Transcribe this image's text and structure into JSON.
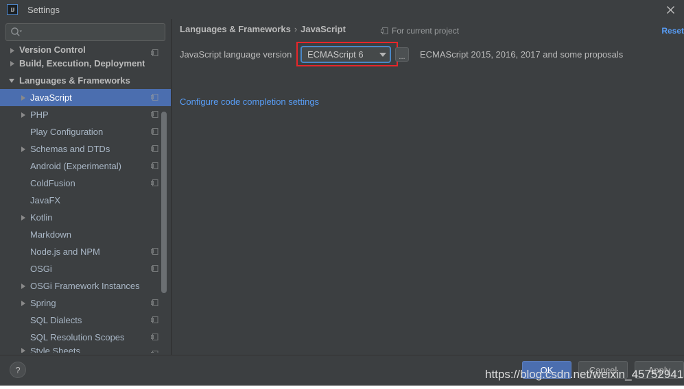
{
  "window": {
    "title": "Settings",
    "logo_text": "IJ",
    "close_icon": "close-icon"
  },
  "sidebar": {
    "search": {
      "value": "",
      "placeholder": "",
      "icon": "search-icon"
    },
    "items": [
      {
        "label": "Version Control",
        "arrow": "right",
        "bold": true,
        "selected": false,
        "project_icon": true,
        "clip": "top"
      },
      {
        "label": "Build, Execution, Deployment",
        "arrow": "right",
        "bold": true,
        "selected": false,
        "project_icon": false,
        "clip": "none"
      },
      {
        "label": "Languages & Frameworks",
        "arrow": "down",
        "bold": true,
        "selected": false,
        "project_icon": false,
        "clip": "none"
      },
      {
        "label": "JavaScript",
        "arrow": "right",
        "bold": false,
        "selected": true,
        "project_icon": true,
        "clip": "none",
        "indent": 1
      },
      {
        "label": "PHP",
        "arrow": "right",
        "bold": false,
        "selected": false,
        "project_icon": true,
        "clip": "none",
        "indent": 1
      },
      {
        "label": "Play Configuration",
        "arrow": "none",
        "bold": false,
        "selected": false,
        "project_icon": true,
        "clip": "none",
        "indent": 1
      },
      {
        "label": "Schemas and DTDs",
        "arrow": "right",
        "bold": false,
        "selected": false,
        "project_icon": true,
        "clip": "none",
        "indent": 1
      },
      {
        "label": "Android (Experimental)",
        "arrow": "none",
        "bold": false,
        "selected": false,
        "project_icon": true,
        "clip": "none",
        "indent": 1
      },
      {
        "label": "ColdFusion",
        "arrow": "none",
        "bold": false,
        "selected": false,
        "project_icon": true,
        "clip": "none",
        "indent": 1
      },
      {
        "label": "JavaFX",
        "arrow": "none",
        "bold": false,
        "selected": false,
        "project_icon": false,
        "clip": "none",
        "indent": 1
      },
      {
        "label": "Kotlin",
        "arrow": "right",
        "bold": false,
        "selected": false,
        "project_icon": false,
        "clip": "none",
        "indent": 1
      },
      {
        "label": "Markdown",
        "arrow": "none",
        "bold": false,
        "selected": false,
        "project_icon": false,
        "clip": "none",
        "indent": 1
      },
      {
        "label": "Node.js and NPM",
        "arrow": "none",
        "bold": false,
        "selected": false,
        "project_icon": true,
        "clip": "none",
        "indent": 1
      },
      {
        "label": "OSGi",
        "arrow": "none",
        "bold": false,
        "selected": false,
        "project_icon": true,
        "clip": "none",
        "indent": 1
      },
      {
        "label": "OSGi Framework Instances",
        "arrow": "right",
        "bold": false,
        "selected": false,
        "project_icon": false,
        "clip": "none",
        "indent": 1
      },
      {
        "label": "Spring",
        "arrow": "right",
        "bold": false,
        "selected": false,
        "project_icon": true,
        "clip": "none",
        "indent": 1
      },
      {
        "label": "SQL Dialects",
        "arrow": "none",
        "bold": false,
        "selected": false,
        "project_icon": true,
        "clip": "none",
        "indent": 1
      },
      {
        "label": "SQL Resolution Scopes",
        "arrow": "none",
        "bold": false,
        "selected": false,
        "project_icon": true,
        "clip": "none",
        "indent": 1
      },
      {
        "label": "Style Sheets",
        "arrow": "right",
        "bold": false,
        "selected": false,
        "project_icon": true,
        "clip": "bottom",
        "indent": 1
      }
    ]
  },
  "main": {
    "breadcrumb_parent": "Languages & Frameworks",
    "breadcrumb_separator": "›",
    "breadcrumb_current": "JavaScript",
    "for_current_project": "For current project",
    "reset_label": "Reset",
    "language_version_label": "JavaScript language version",
    "combo_value": "ECMAScript 6",
    "ellipsis_label": "...",
    "version_description": "ECMAScript 2015, 2016, 2017 and some proposals",
    "configure_link": "Configure code completion settings"
  },
  "footer": {
    "help_label": "?",
    "ok_label": "OK",
    "cancel_label": "Cancel",
    "apply_label": "Apply"
  },
  "overlay": {
    "watermark": "https://blog.csdn.net/weixin_45752941"
  },
  "colors": {
    "background": "#3c3f41",
    "selection": "#4b6eaf",
    "link": "#589df6",
    "highlight": "#e8262a",
    "focus_border": "#4a88c7",
    "text": "#bbbbbb"
  }
}
